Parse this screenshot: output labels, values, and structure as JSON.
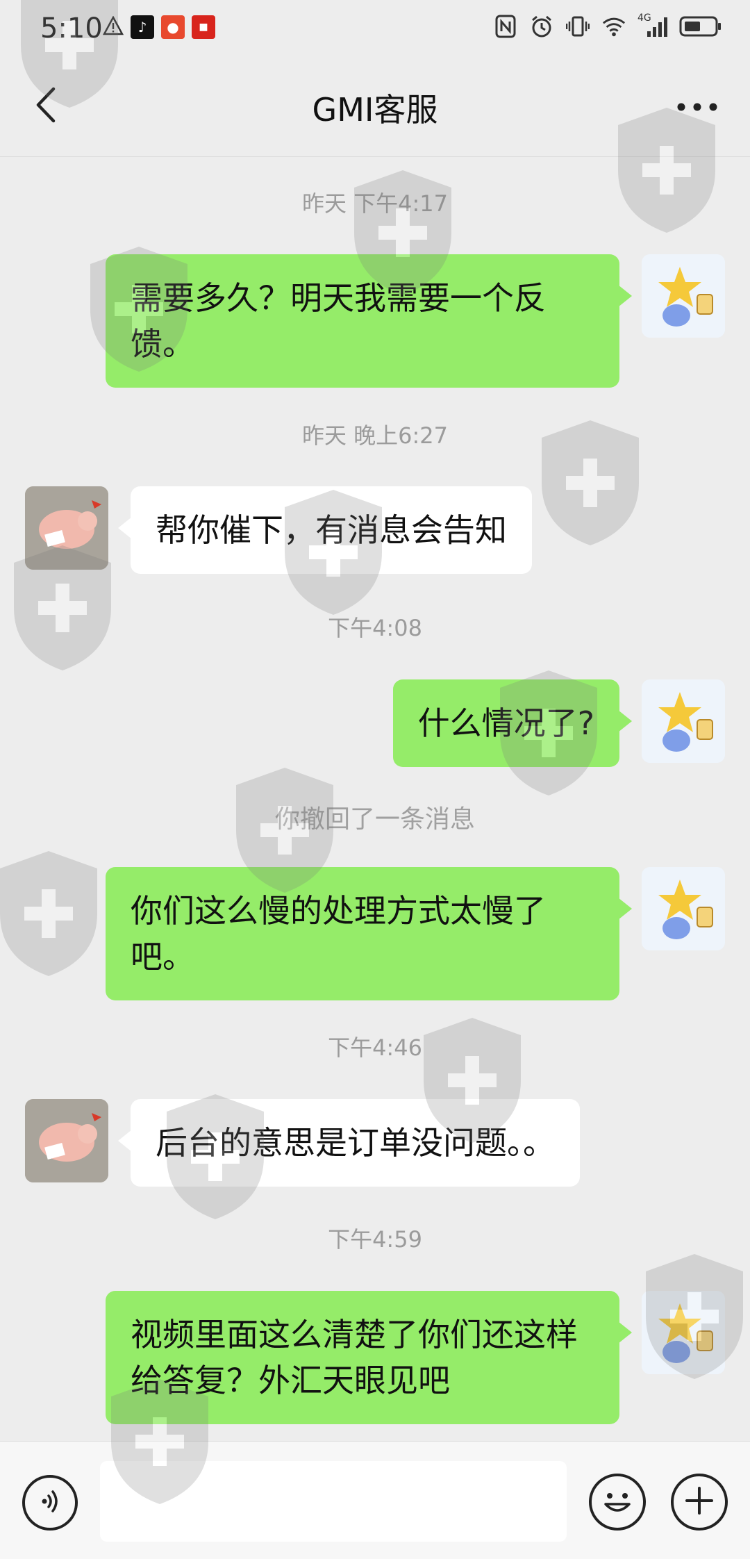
{
  "status_bar": {
    "time": "5:10",
    "left_icons": [
      "warning-icon",
      "tiktok-icon",
      "app-icon",
      "news-icon"
    ],
    "right_icons": [
      "nfc-icon",
      "alarm-icon",
      "vibrate-icon",
      "wifi-icon",
      "signal-4g-icon",
      "battery-icon"
    ],
    "network": "4G"
  },
  "nav": {
    "title": "GMI客服",
    "back_icon": "chevron-left-icon",
    "more_icon": "more-dots-icon"
  },
  "messages": [
    {
      "type": "time",
      "text": "昨天 下午4:17"
    },
    {
      "type": "bubble",
      "sender": "me",
      "text": "需要多久？明天我需要一个反馈。"
    },
    {
      "type": "time",
      "text": "昨天 晚上6:27"
    },
    {
      "type": "bubble",
      "sender": "them",
      "text": "帮你催下，有消息会告知"
    },
    {
      "type": "time",
      "text": "下午4:08"
    },
    {
      "type": "bubble",
      "sender": "me",
      "text": "什么情况了?"
    },
    {
      "type": "notice",
      "text": "你撤回了一条消息"
    },
    {
      "type": "bubble",
      "sender": "me",
      "text": "你们这么慢的处理方式太慢了吧。"
    },
    {
      "type": "time",
      "text": "下午4:46"
    },
    {
      "type": "bubble",
      "sender": "them",
      "text": "后台的意思是订单没问题。。"
    },
    {
      "type": "time",
      "text": "下午4:59"
    },
    {
      "type": "bubble",
      "sender": "me",
      "text": "视频里面这么清楚了你们还这样给答复？外汇天眼见吧"
    }
  ],
  "input_bar": {
    "placeholder": "",
    "voice_icon": "voice-icon",
    "emoji_icon": "emoji-icon",
    "plus_icon": "plus-icon"
  },
  "colors": {
    "background": "#ededed",
    "my_bubble": "#95ec69",
    "their_bubble": "#ffffff",
    "time_text": "#9b9b9b"
  }
}
